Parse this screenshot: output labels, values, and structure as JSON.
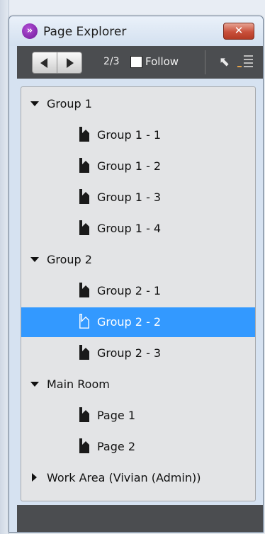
{
  "window": {
    "title": "Page Explorer",
    "close_label": "✕",
    "app_icon_glyph": "»"
  },
  "toolbar": {
    "page_count": "2/3",
    "follow_label": "Follow",
    "follow_checked": false,
    "prev_icon": "triangle-left-icon",
    "next_icon": "triangle-right-icon",
    "back_icon_glyph": "⬉",
    "list_icon": "list-icon"
  },
  "tree": {
    "groups": [
      {
        "label": "Group 1",
        "expanded": true,
        "pages": [
          "Group 1 -  1",
          "Group 1 -  2",
          "Group 1 -  3",
          "Group 1 -  4"
        ]
      },
      {
        "label": "Group 2",
        "expanded": true,
        "pages": [
          "Group 2 -  1",
          "Group 2 -  2",
          "Group 2 -  3"
        ]
      },
      {
        "label": "Main Room",
        "expanded": true,
        "pages": [
          "Page 1",
          "Page 2"
        ]
      },
      {
        "label": "Work Area (Vivian (Admin))",
        "expanded": false,
        "pages": []
      }
    ],
    "selected_page": "Group 2 -  2"
  },
  "colors": {
    "selection": "#3399ff",
    "toolbar": "#4b4d50",
    "tree_background": "#e3e4e6",
    "page_icon": "#1a1a1a"
  }
}
